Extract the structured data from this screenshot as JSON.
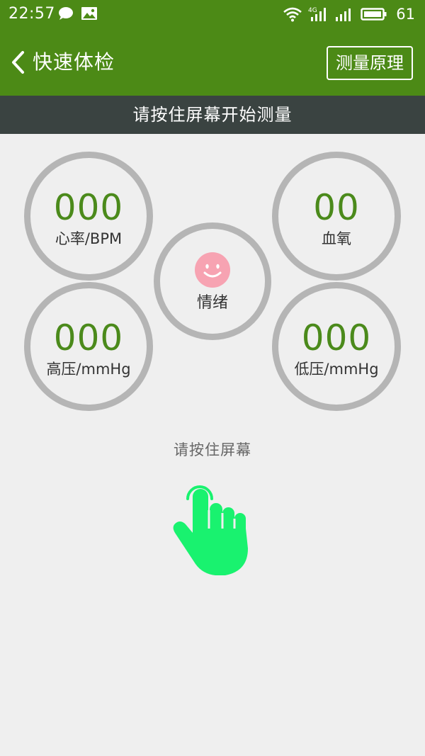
{
  "status_bar": {
    "time": "22:57",
    "battery_level": "61",
    "network_label": "4G",
    "icons": [
      "chat-bubble-icon",
      "image-icon",
      "wifi-icon",
      "signal-4g-icon",
      "signal-icon",
      "battery-icon"
    ]
  },
  "app_bar": {
    "title": "快速体检",
    "principle_button_label": "测量原理"
  },
  "instruction_banner": {
    "text": "请按住屏幕开始测量"
  },
  "metrics": {
    "heart_rate": {
      "value": "000",
      "unit": "心率/BPM"
    },
    "blood_oxygen": {
      "value": "00",
      "unit": "血氧"
    },
    "mood": {
      "label": "情绪",
      "icon": "smiley-face-icon"
    },
    "systolic": {
      "value": "000",
      "unit": "高压/mmHg"
    },
    "diastolic": {
      "value": "000",
      "unit": "低压/mmHg"
    }
  },
  "press_area": {
    "hint": "请按住屏幕",
    "icon": "finger-press-icon"
  },
  "colors": {
    "app_bar_green": "#4c8a16",
    "banner_dark": "#3a4341",
    "value_green": "#4b8a1b",
    "ring_gray": "#b5b5b5",
    "background": "#efefef",
    "mood_pink": "#f7a3b2",
    "finger_green": "#19f26f"
  }
}
